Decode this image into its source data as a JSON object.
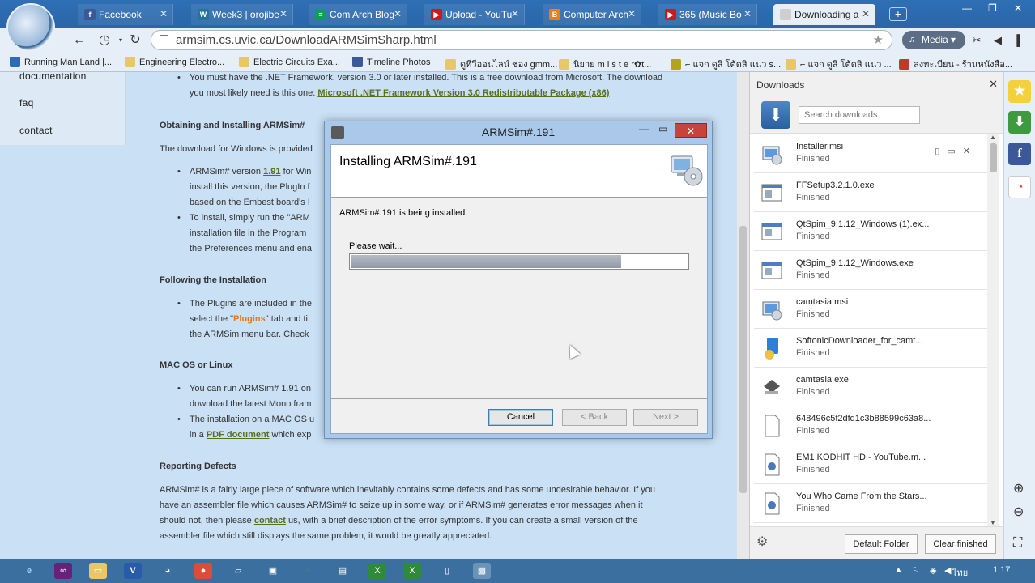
{
  "browser": {
    "tabs": [
      {
        "title": "Facebook",
        "icon": "facebook-icon",
        "color": "#3b5998",
        "glyph": "f"
      },
      {
        "title": "Week3 | orojibe",
        "icon": "wordpress-icon",
        "color": "#21759b",
        "glyph": "W"
      },
      {
        "title": "Com Arch Blog",
        "icon": "sheets-icon",
        "color": "#0f9d58",
        "glyph": "≡"
      },
      {
        "title": "Upload - YouTu",
        "icon": "youtube-icon",
        "color": "#cc181e",
        "glyph": "▶"
      },
      {
        "title": "Computer Arch",
        "icon": "blogger-icon",
        "color": "#f57d00",
        "glyph": "B"
      },
      {
        "title": "365 (Music Bo",
        "icon": "youtube-icon",
        "color": "#cc181e",
        "glyph": "▶"
      },
      {
        "title": "Downloading a",
        "icon": "page-icon",
        "color": "#cfcfcf",
        "glyph": ""
      }
    ],
    "new_tab": "+",
    "window_controls": [
      "—",
      "❐",
      "✕"
    ],
    "url": "armsim.cs.uvic.ca/DownloadARMSimSharp.html",
    "media_label": "Media",
    "bookmarks": [
      {
        "label": "Running Man Land |...",
        "color": "#2a6ebb"
      },
      {
        "label": "Engineering Electro...",
        "color": "#e8c766"
      },
      {
        "label": "Electric Circuits Exa...",
        "color": "#e8c766"
      },
      {
        "label": "Timeline Photos",
        "color": "#3b5998"
      },
      {
        "label": "ดูทีวีออนไลน์ ช่อง gmm...",
        "color": "#e8c766"
      },
      {
        "label": "นิยาย m i s t e r✿t...",
        "color": "#e8c766"
      },
      {
        "label": "⌐ แจก ดูสิ โต้ดสิ แนว s...",
        "color": "#b5a21d"
      },
      {
        "label": "⌐ แจก ดูสิ โต้ดสิ แนว ...",
        "color": "#e8c766"
      },
      {
        "label": "ลงทะเบียน - ร้านหนังสือ...",
        "color": "#c0392b"
      }
    ]
  },
  "page": {
    "leftnav": [
      "documentation",
      "faq",
      "contact"
    ],
    "req_line1_pre": "You must have the .NET Framework, version 3.0 or later installed. This is a free download from Microsoft. The download",
    "req_line2_pre": "you most likely need is this one:",
    "req_link": "Microsoft .NET Framework Version 3.0 Redistributable Package (x86)",
    "h_obtaining": "Obtaining and Installing ARMSim#",
    "obtaining_text": "The download for Windows is provided",
    "armsim_pre": "ARMSim# version",
    "armsim_version": "1.91",
    "armsim_post": "for Win",
    "install_l2": "install this version, the PlugIn f",
    "install_l3": "based on the Embest board's I",
    "install_l4": "To install, simply run the \"ARM",
    "install_l5": "installation file in the Program",
    "install_l6": "the Preferences menu and ena",
    "h_following": "Following the Installation",
    "plugins_l1": "The Plugins are included in the",
    "plugins_l2_pre": "select the \"",
    "plugins_word": "Plugins",
    "plugins_l2_post": "\" tab and ti",
    "plugins_l3": "the ARMSim menu bar. Check",
    "h_mac": "MAC OS or Linux",
    "mac_l1": "You can run ARMSim# 1.91 on",
    "mac_l2": "download the latest Mono fram",
    "mac_l3": "The installation on a MAC OS u",
    "mac_l4_pre": "in a",
    "mac_link": "PDF document",
    "mac_l4_post": "which exp",
    "h_reporting": "Reporting Defects",
    "rep_l1": "ARMSim# is a fairly large piece of software which inevitably contains some defects and has some undesirable behavior. If you",
    "rep_l2": "have an assembler file which causes ARMSim# to seize up in some way, or if ARMSim# generates error messages when it",
    "rep_l3_pre": "should not, then please",
    "rep_link": "contact",
    "rep_l3_post": "us, with a brief description of the error symptoms. If you can create a small version of the",
    "rep_l4": "assembler file which still displays the same problem, it would be greatly appreciated."
  },
  "dialog": {
    "title": "ARMSim#.191",
    "heading": "Installing ARMSim#.191",
    "message": "ARMSim#.191 is being installed.",
    "wait": "Please wait...",
    "progress": 0.8,
    "cancel": "Cancel",
    "back": "< Back",
    "next": "Next >"
  },
  "downloads": {
    "title": "Downloads",
    "search_placeholder": "Search downloads",
    "default_folder": "Default Folder",
    "clear_finished": "Clear finished",
    "items": [
      {
        "name": "Installer.msi",
        "status": "Finished",
        "icon": "installer-icon"
      },
      {
        "name": "FFSetup3.2.1.0.exe",
        "status": "Finished",
        "icon": "exe-icon"
      },
      {
        "name": "QtSpim_9.1.12_Windows (1).ex...",
        "status": "Finished",
        "icon": "exe-icon"
      },
      {
        "name": "QtSpim_9.1.12_Windows.exe",
        "status": "Finished",
        "icon": "exe-icon"
      },
      {
        "name": "camtasia.msi",
        "status": "Finished",
        "icon": "installer-icon"
      },
      {
        "name": "SoftonicDownloader_for_camt...",
        "status": "Finished",
        "icon": "softonic-icon"
      },
      {
        "name": "camtasia.exe",
        "status": "Finished",
        "icon": "camtasia-icon"
      },
      {
        "name": "648496c5f2dfd1c3b88599c63a8...",
        "status": "Finished",
        "icon": "file-icon"
      },
      {
        "name": "EM1 KODHIT HD - YouTube.m...",
        "status": "Finished",
        "icon": "media-file-icon"
      },
      {
        "name": "You Who Came From the Stars...",
        "status": "Finished",
        "icon": "media-file-icon"
      }
    ]
  },
  "taskbar": {
    "tray_lang": "ไทย",
    "clock": "1:17"
  }
}
